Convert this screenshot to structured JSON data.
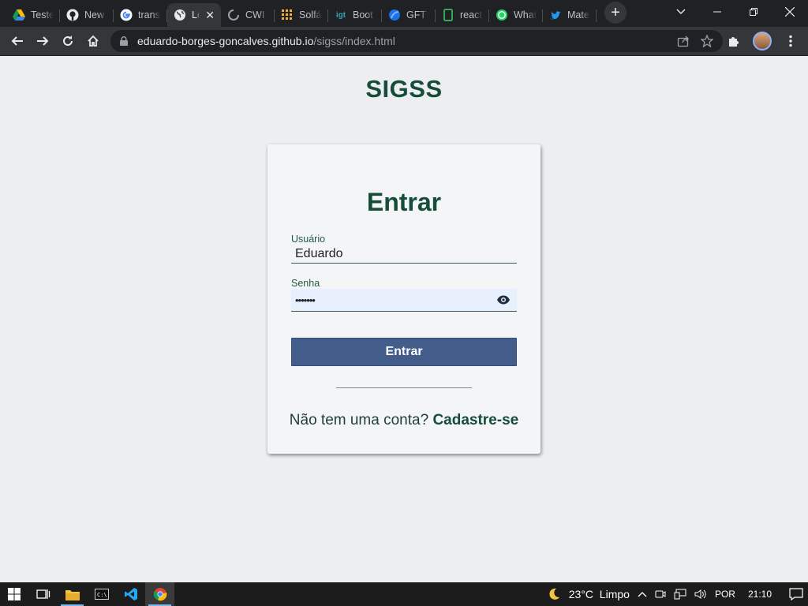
{
  "browser": {
    "tabs": [
      {
        "label": "Teste",
        "icon": "google-drive-icon",
        "active": false
      },
      {
        "label": "New",
        "icon": "github-icon",
        "active": false
      },
      {
        "label": "trans",
        "icon": "google-icon",
        "active": false
      },
      {
        "label": "Lo",
        "icon": "globe-icon",
        "active": true
      },
      {
        "label": "CWI",
        "icon": "loading-icon",
        "active": false
      },
      {
        "label": "Solfá",
        "icon": "grid-icon",
        "active": false
      },
      {
        "label": "Boot",
        "icon": "igt-icon",
        "active": false
      },
      {
        "label": "GFT",
        "icon": "gft-icon",
        "active": false
      },
      {
        "label": "react",
        "icon": "phone-icon",
        "active": false
      },
      {
        "label": "What",
        "icon": "whatsapp-icon",
        "active": false
      },
      {
        "label": "Mate",
        "icon": "twitter-icon",
        "active": false
      }
    ],
    "address": {
      "host": "eduardo-borges-goncalves.github.io",
      "path": "/sigss/index.html"
    }
  },
  "page": {
    "brand": "SIGSS",
    "login_title": "Entrar",
    "username": {
      "label": "Usuário",
      "value": "Eduardo"
    },
    "password": {
      "label": "Senha",
      "value": "•••••••"
    },
    "submit_label": "Entrar",
    "signup_prompt": "Não tem uma conta?",
    "signup_link": "Cadastre-se"
  },
  "taskbar": {
    "weather": "23°C  Limpo",
    "language": "POR",
    "time": "21:10"
  },
  "colors": {
    "brand_green": "#154c3a",
    "button_blue": "#435d8b",
    "autofill_bg": "#e8f0fe"
  }
}
